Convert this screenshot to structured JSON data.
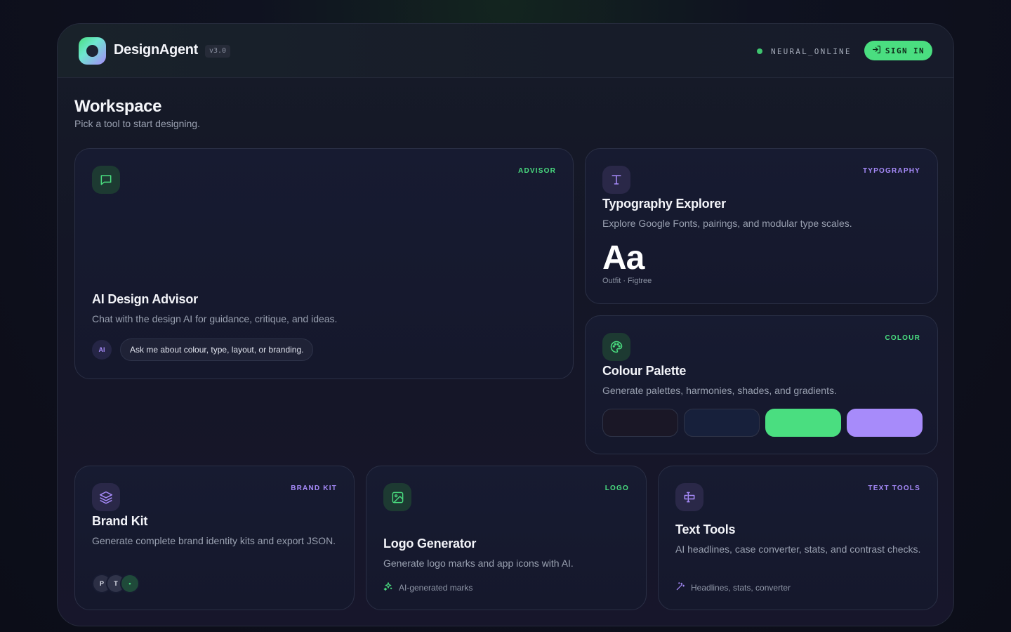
{
  "header": {
    "brand": "DesignAgent",
    "version": "v3.0",
    "status": "NEURAL_ONLINE",
    "signin_label": "SIGN IN"
  },
  "workspace": {
    "title": "Workspace",
    "subtitle": "Pick a tool to start designing."
  },
  "cards": {
    "advisor": {
      "tag": "ADVISOR",
      "title": "AI Design Advisor",
      "desc": "Chat with the design AI for guidance, critique, and ideas.",
      "avatar": "AI",
      "bubble": "Ask me about colour, type, layout, or branding."
    },
    "typography": {
      "tag": "TYPOGRAPHY",
      "title": "Typography Explorer",
      "desc": "Explore Google Fonts, pairings, and modular type scales.",
      "sample": "Aa",
      "fonts": "Outfit · Figtree"
    },
    "colour": {
      "tag": "COLOUR",
      "title": "Colour Palette",
      "desc": "Generate palettes, harmonies, shades, and gradients.",
      "swatches": [
        "#1a1726",
        "#17203b",
        "#4ade80",
        "#a78bfa"
      ]
    },
    "brandkit": {
      "tag": "BRAND KIT",
      "title": "Brand Kit",
      "desc": "Generate complete brand identity kits and export JSON.",
      "avatars": [
        "P",
        "T",
        "•"
      ]
    },
    "logo": {
      "tag": "LOGO",
      "title": "Logo Generator",
      "desc": "Generate logo marks and app icons with AI.",
      "footer": "AI-generated marks"
    },
    "texttools": {
      "tag": "TEXT TOOLS",
      "title": "Text Tools",
      "desc": "AI headlines, case converter, stats, and contrast checks.",
      "footer": "Headlines, stats, converter"
    }
  },
  "colors": {
    "accent_green": "#4ade80",
    "accent_purple": "#a78bfa",
    "background": "#141626"
  }
}
